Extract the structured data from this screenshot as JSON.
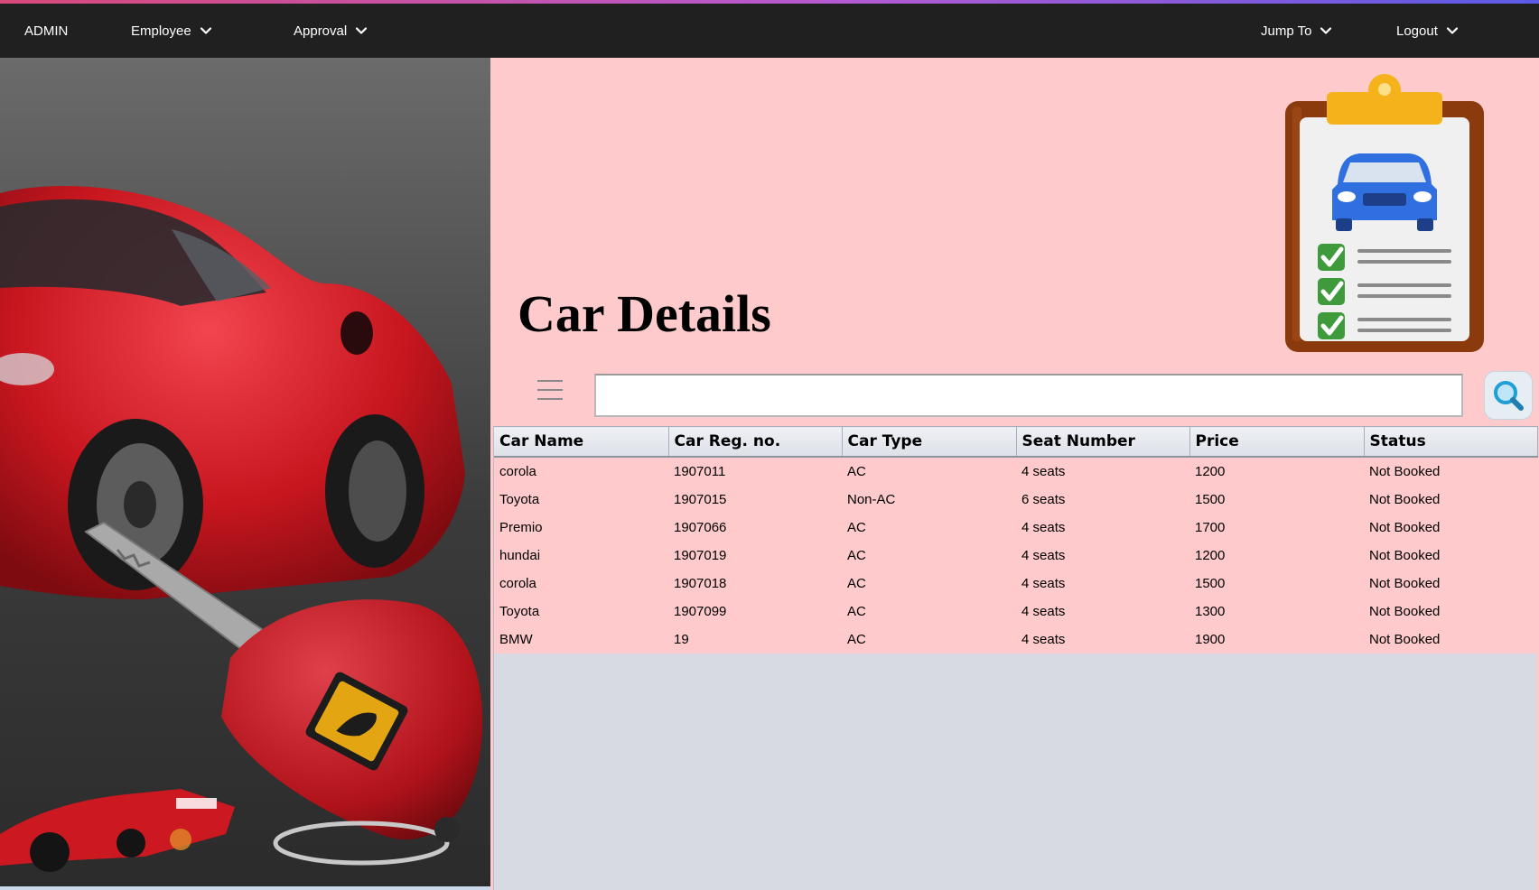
{
  "nav": {
    "admin": "ADMIN",
    "employee": "Employee",
    "approval": "Approval",
    "jump_to": "Jump To",
    "logout": "Logout"
  },
  "page": {
    "title": "Car Details",
    "search_value": ""
  },
  "table": {
    "columns": [
      "Car Name",
      "Car Reg. no.",
      "Car Type",
      "Seat Number",
      "Price",
      "Status"
    ],
    "rows": [
      [
        "corola",
        "1907011",
        "AC",
        "4 seats",
        "1200",
        "Not Booked"
      ],
      [
        "Toyota",
        "1907015",
        "Non-AC",
        "6 seats",
        "1500",
        "Not Booked"
      ],
      [
        "Premio",
        "1907066",
        "AC",
        "4 seats",
        "1700",
        "Not Booked"
      ],
      [
        "hundai",
        "1907019",
        "AC",
        "4 seats",
        "1200",
        "Not Booked"
      ],
      [
        "corola",
        "1907018",
        "AC",
        "4 seats",
        "1500",
        "Not Booked"
      ],
      [
        "Toyota",
        "1907099",
        "AC",
        "4 seats",
        "1300",
        "Not Booked"
      ],
      [
        "BMW",
        "19",
        "AC",
        "4 seats",
        "1900",
        "Not Booked"
      ]
    ]
  },
  "icons": {
    "menu": "hamburger-menu-icon",
    "search": "search-icon",
    "dropdown": "chevron-down-icon",
    "clipboard": "car-checklist-clipboard-icon"
  },
  "colors": {
    "navbar": "#202020",
    "content_background": "#fecacb",
    "table_empty_area": "#d7dae2"
  }
}
